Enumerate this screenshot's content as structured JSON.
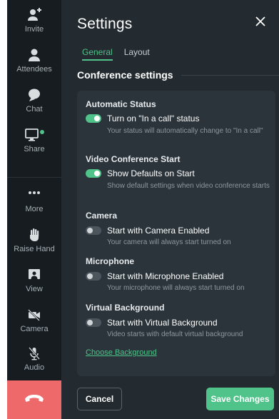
{
  "colors": {
    "accent": "#4fc38a",
    "leave": "#ee6a6a",
    "panel_bg": "#232b30",
    "rail_bg": "#161c20",
    "card_bg": "#2b343a"
  },
  "sidebar": {
    "items": [
      {
        "label": "Invite",
        "icon": "add-person-icon"
      },
      {
        "label": "Attendees",
        "icon": "person-icon"
      },
      {
        "label": "Chat",
        "icon": "chat-bubble-icon"
      },
      {
        "label": "Share",
        "icon": "monitor-icon"
      },
      {
        "label": "More",
        "icon": "more-dots-icon"
      },
      {
        "label": "Raise Hand",
        "icon": "hand-icon"
      },
      {
        "label": "View",
        "icon": "view-icon"
      },
      {
        "label": "Camera",
        "icon": "camera-off-icon"
      },
      {
        "label": "Audio",
        "icon": "mic-off-icon"
      }
    ],
    "leave_icon": "phone-hangup-icon"
  },
  "settings": {
    "title": "Settings",
    "close_icon": "close-icon",
    "tabs": [
      {
        "label": "General",
        "active": true
      },
      {
        "label": "Layout",
        "active": false
      }
    ],
    "section_heading": "Conference settings",
    "groups": [
      {
        "title": "Automatic Status",
        "toggle_label": "Turn on \"In a call\" status",
        "enabled": true,
        "description": "Your status will automatically change to \"In a call\""
      },
      {
        "title": "Video Conference Start",
        "toggle_label": "Show Defaults on Start",
        "enabled": true,
        "description": "Show default settings when video conference starts"
      },
      {
        "title": "Camera",
        "toggle_label": "Start with Camera Enabled",
        "enabled": false,
        "description": "Your camera will always start turned on"
      },
      {
        "title": "Microphone",
        "toggle_label": "Start with Microphone Enabled",
        "enabled": false,
        "description": "Your microphone will always start turned on"
      },
      {
        "title": "Virtual Background",
        "toggle_label": "Start with Virtual Background",
        "enabled": false,
        "description": "Video starts with default virtual background"
      }
    ],
    "choose_background_link": "Choose Background",
    "cancel_label": "Cancel",
    "save_label": "Save Changes"
  }
}
